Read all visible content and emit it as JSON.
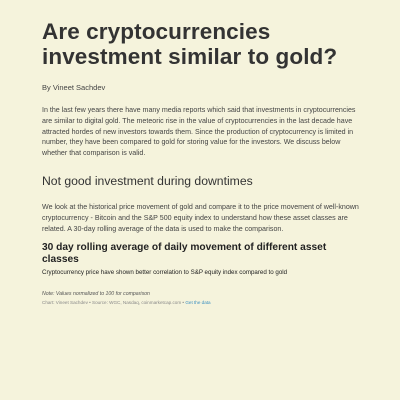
{
  "article": {
    "title": "Are cryptocurrencies investment similar to gold?",
    "byline": "By Vineet Sachdev",
    "intro": "In the last few years there have many media reports which said that investments in cryptocurrencies are similar to digital gold. The meteoric rise in the value of cryptocurrencies in the last decade have attracted hordes of new investors towards them. Since the production of cryptocurrency is limited in number, they have been compared to gold for storing value for the investors. We discuss below whether that comparison is valid.",
    "section_heading": "Not good investment during downtimes",
    "section_body": "We look at the historical price movement of gold and compare it to the price movement of well-known cryptocurrency - Bitcoin and the S&P 500 equity index to understand how these asset classes are related. A 30-day rolling average of the data is used to make the comparison."
  },
  "chart": {
    "title": "30 day rolling average of daily movement of different asset classes",
    "subtitle": "Cryptocurrency price have shown better correlation to S&P equity index compared to gold",
    "note": "Note: Values normalized to 100 for comparison",
    "source_text": "Chart: Vineet Sachdev • Source: WGC, Nasdaq, coinmarketcap.com • ",
    "data_link": "Get the data",
    "link_color": "#3a8fc0"
  }
}
